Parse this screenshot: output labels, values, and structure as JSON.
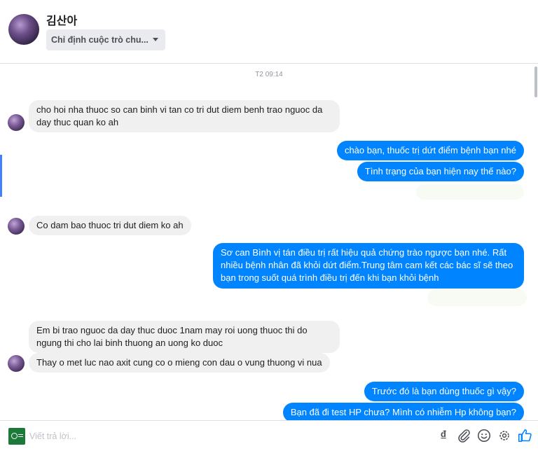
{
  "header": {
    "name": "김산아",
    "assign_label": "Chỉ định cuộc trò chu..."
  },
  "timestamp": "T2 09:14",
  "messages": {
    "m1": "cho hoi nha thuoc so can binh vi tan co tri dut diem benh trao nguoc da day thuc quan ko ah",
    "m2": "chào bạn, thuốc trị dứt điểm bệnh bạn nhé",
    "m3": "Tình trạng của bạn hiện nay thế nào?",
    "m4": "Co dam bao thuoc tri dut diem ko ah",
    "m5": "Sơ can Bình vị tán điều trị rất hiệu quả chứng trào ngược bạn nhé. Rất nhiều bệnh nhân đã khỏi dứt điểm.Trung tâm cam kết các bác sĩ sẽ theo bạn trong suốt quá trình điều trị đến khi bạn khỏi bệnh",
    "m6": "Em bi trao nguoc da day thuc duoc 1nam may roi uong thuoc thi do ngung thi cho lai binh thuong   an uong ko duoc",
    "m7": "Thay o met luc nao axit cung co o mieng con dau o vung thuong vi nua",
    "m8": "Trước đó là bạn dùng thuốc gì vậy?",
    "m9": "Bạn đã đi test HP chưa? Mình có nhiễm Hp không bạn?"
  },
  "composer": {
    "placeholder": "Viết trả lời...",
    "currency_symbol": "₫",
    "icons": [
      "currency-icon",
      "attachment-icon",
      "emoji-icon",
      "settings-icon",
      "like-icon"
    ]
  },
  "colors": {
    "outgoing": "#0084ff",
    "incoming": "#f1f0f0",
    "accent": "#4080ff"
  }
}
